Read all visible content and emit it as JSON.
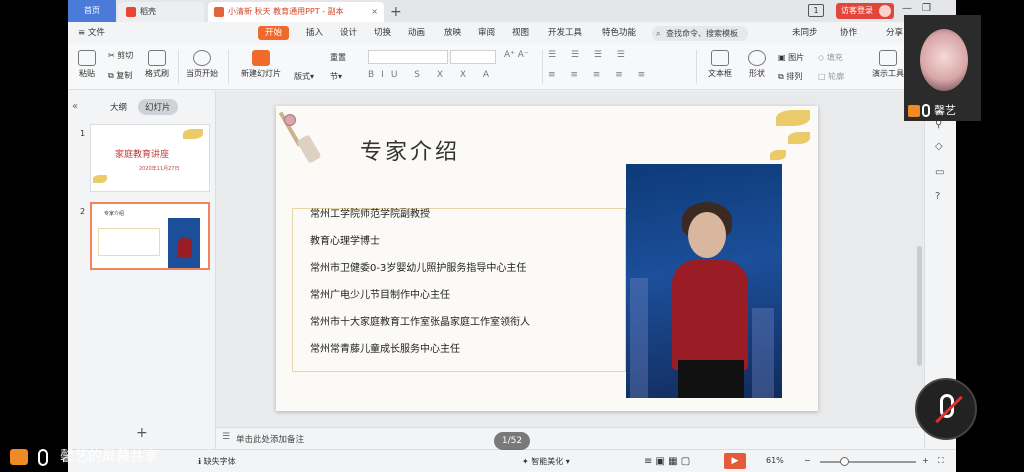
{
  "tabs": {
    "home": "首页",
    "daoke": "稻壳",
    "doc": "小清新 秋天 教育通用PPT - 副本",
    "close": "×",
    "add": "+"
  },
  "titlebar": {
    "badge": "1",
    "login": "访客登录",
    "minimize": "—",
    "restore": "❐"
  },
  "menu": {
    "file": "≡ 文件",
    "items": [
      "开始",
      "插入",
      "设计",
      "切换",
      "动画",
      "放映",
      "审阅",
      "视图",
      "开发工具",
      "特色功能"
    ],
    "search_placeholder": "查找命令、搜索模板",
    "unsync": "未同步",
    "collab": "协作",
    "share": "分享"
  },
  "ribbon": {
    "paste": "粘贴",
    "cut": "剪切",
    "copy": "复制",
    "format_painter": "格式刷",
    "play_from_current": "当页开始",
    "new_slide": "新建幻灯片",
    "layout": "版式",
    "section": "节",
    "reset": "重置",
    "textbox": "文本框",
    "shape": "形状",
    "arrange": "排列",
    "picture": "图片",
    "fill": "填充",
    "outline": "轮廓",
    "presentation_tools": "演示工具"
  },
  "leftpanel": {
    "outline_tab": "大纲",
    "slides_tab": "幻灯片",
    "slide1_num": "1",
    "slide1_title": "家庭教育讲座",
    "slide1_date": "2020年11月27日",
    "slide2_num": "2",
    "slide2_title": "专家介绍",
    "add": "+"
  },
  "slide": {
    "title": "专家介绍",
    "bio": [
      "常州工学院师范学院副教授",
      "教育心理学博士",
      "常州市卫健委0-3岁婴幼儿照护服务指导中心主任",
      "常州广电少儿节目制作中心主任",
      "常州市十大家庭教育工作室张晶家庭工作室领衔人",
      "常州常青藤儿童成长服务中心主任"
    ]
  },
  "notes": {
    "placeholder": "单击此处添加备注"
  },
  "status": {
    "missing_font": "缺失字体",
    "smart_beautify": "智能美化",
    "zoom": "61%",
    "page": "1/52"
  },
  "overlay": {
    "participant_name": "馨艺",
    "share_label": "馨艺的屏幕共享"
  },
  "colors": {
    "accent_orange": "#f06a2c",
    "tab_blue": "#4a7bd9",
    "login_red": "#e0463a",
    "slide_frame_gold": "#e8d6a6",
    "thumb_active": "#f2845c"
  }
}
